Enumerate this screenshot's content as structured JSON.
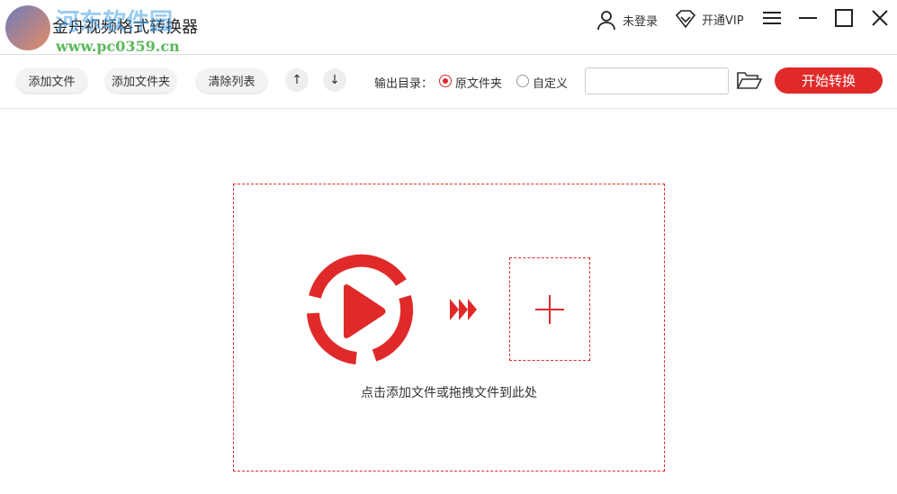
{
  "app": {
    "title": "金舟视频格式转换器",
    "watermark_name": "河东软件园",
    "watermark_url": "www.pc0359.cn"
  },
  "header": {
    "login": "未登录",
    "vip": "开通VIP"
  },
  "toolbar": {
    "add_file": "添加文件",
    "add_folder": "添加文件夹",
    "clear_list": "清除列表",
    "output_dir_label": "输出目录：",
    "option_source": "原文件夹",
    "option_custom": "自定义",
    "selected": "原文件夹",
    "path_value": "",
    "start": "开始转换"
  },
  "drop": {
    "hint": "点击添加文件或拖拽文件到此处"
  },
  "colors": {
    "accent": "#e02a2a"
  }
}
